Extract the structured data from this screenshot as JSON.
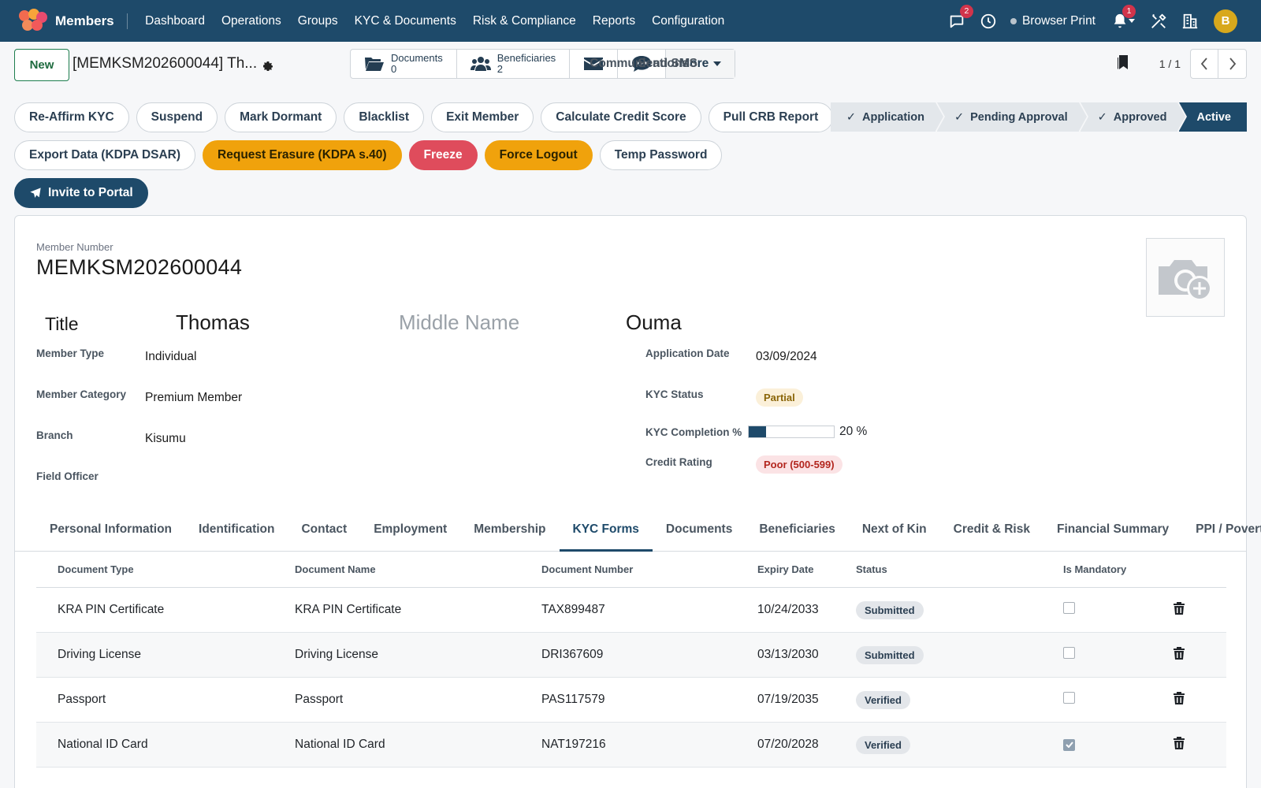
{
  "app": {
    "name": "Members",
    "nav": [
      "Dashboard",
      "Operations",
      "Groups",
      "KYC & Documents",
      "Risk & Compliance",
      "Reports",
      "Configuration"
    ],
    "messages_badge": "2",
    "notifications_badge": "1",
    "browser_print": "Browser Print",
    "avatar_letter": "B"
  },
  "control": {
    "new_label": "New",
    "record_title": "[MEMKSM202600044] Th...",
    "stat_buttons": {
      "documents_label": "Documents",
      "documents_count": "0",
      "beneficiaries_label": "Beneficiaries",
      "beneficiaries_count": "2",
      "communications_label": "Communications",
      "send_sms_label": "Send SMS",
      "more_label": "More"
    },
    "pager": "1 / 1"
  },
  "actions": {
    "row1": [
      "Re-Affirm KYC",
      "Suspend",
      "Mark Dormant",
      "Blacklist",
      "Exit Member",
      "Calculate Credit Score",
      "Pull CRB Report"
    ],
    "export": "Export Data (KDPA DSAR)",
    "erasure": "Request Erasure (KDPA s.40)",
    "freeze": "Freeze",
    "force_logout": "Force Logout",
    "temp_password": "Temp Password",
    "invite": "Invite to Portal"
  },
  "statusbar": {
    "stages": [
      "Application",
      "Pending Approval",
      "Approved",
      "Active"
    ],
    "check": "✓"
  },
  "form": {
    "member_number_label": "Member Number",
    "member_number": "MEMKSM202600044",
    "title": "Title",
    "first_name": "Thomas",
    "middle_name_placeholder": "Middle Name",
    "last_name": "Ouma",
    "left_fields": {
      "member_type_label": "Member Type",
      "member_type": "Individual",
      "member_category_label": "Member Category",
      "member_category": "Premium Member",
      "branch_label": "Branch",
      "branch": "Kisumu",
      "field_officer_label": "Field Officer"
    },
    "right_fields": {
      "application_date_label": "Application Date",
      "application_date": "03/09/2024",
      "kyc_status_label": "KYC Status",
      "kyc_status": "Partial",
      "kyc_completion_label": "KYC Completion %",
      "kyc_completion_value": "20 %",
      "kyc_completion_fraction": 0.2,
      "credit_rating_label": "Credit Rating",
      "credit_rating": "Poor (500-599)"
    }
  },
  "tabs": [
    "Personal Information",
    "Identification",
    "Contact",
    "Employment",
    "Membership",
    "KYC Forms",
    "Documents",
    "Beneficiaries",
    "Next of Kin",
    "Credit & Risk",
    "Financial Summary",
    "PPI / Poverty"
  ],
  "active_tab": "KYC Forms",
  "table": {
    "headers": [
      "Document Type",
      "Document Name",
      "Document Number",
      "Expiry Date",
      "Status",
      "Is Mandatory"
    ],
    "rows": [
      {
        "type": "KRA PIN Certificate",
        "name": "KRA PIN Certificate",
        "number": "TAX899487",
        "expiry": "10/24/2033",
        "status": "Submitted",
        "mandatory": false
      },
      {
        "type": "Driving License",
        "name": "Driving License",
        "number": "DRI367609",
        "expiry": "03/13/2030",
        "status": "Submitted",
        "mandatory": false
      },
      {
        "type": "Passport",
        "name": "Passport",
        "number": "PAS117579",
        "expiry": "07/19/2035",
        "status": "Verified",
        "mandatory": false
      },
      {
        "type": "National ID Card",
        "name": "National ID Card",
        "number": "NAT197216",
        "expiry": "07/20/2028",
        "status": "Verified",
        "mandatory": true
      }
    ]
  },
  "colors": {
    "navbar": "#1e4a6a",
    "accent_orange": "#f0a20c",
    "accent_red": "#df4c5c",
    "avatar": "#d8a81c"
  }
}
